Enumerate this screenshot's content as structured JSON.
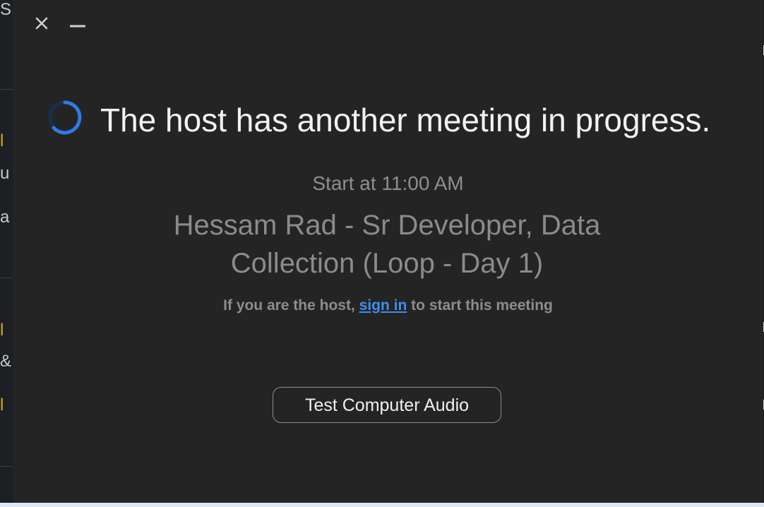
{
  "window_controls": {
    "close_icon": "close-icon",
    "minimize_icon": "minimize-icon"
  },
  "status": {
    "spinner_icon": "loading-spinner-icon",
    "spinner_color": "#2f7ae5",
    "title": "The host has another meeting in progress."
  },
  "meeting": {
    "start_time": "Start at 11:00 AM",
    "name": "Hessam Rad - Sr Developer, Data Collection (Loop - Day 1)"
  },
  "host_note": {
    "prefix": "If you are the host,",
    "link_label": "sign in",
    "suffix": "to start this meeting"
  },
  "actions": {
    "test_audio_label": "Test Computer Audio"
  },
  "background_window": {
    "visible_chars": [
      "S",
      "l",
      "u",
      "a",
      "l",
      "&",
      "l"
    ]
  }
}
